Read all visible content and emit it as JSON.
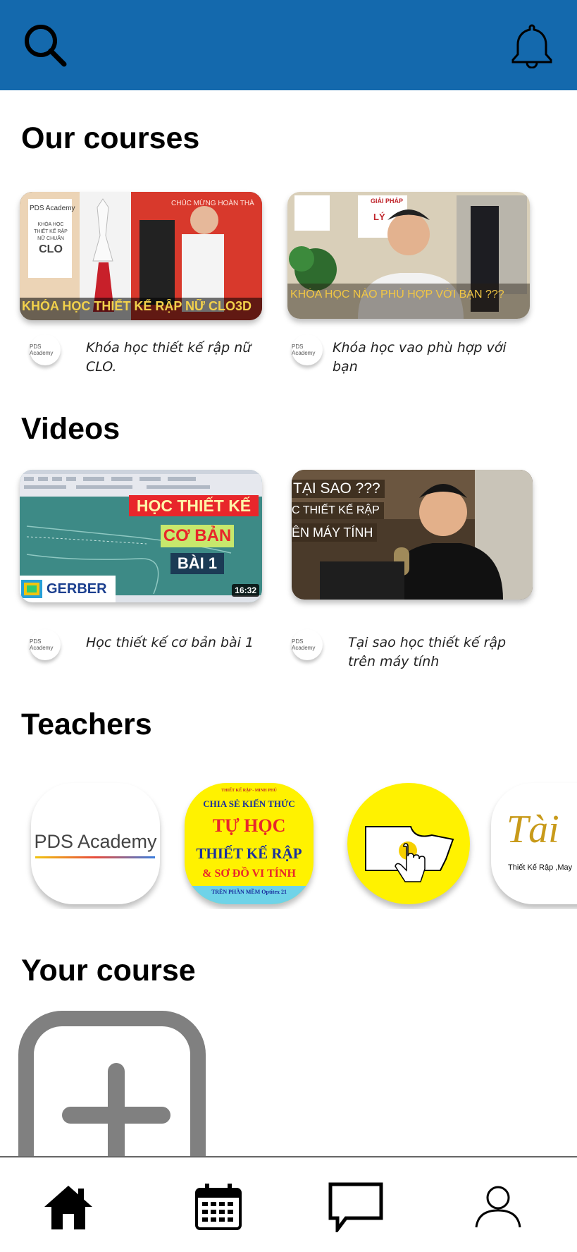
{
  "sections": {
    "courses_title": "Our courses",
    "videos_title": "Videos",
    "teachers_title": "Teachers",
    "your_course_title": "Your course"
  },
  "courses": [
    {
      "banner": "KHÓA HỌC THIẾT KẾ RẬP NỮ CLO3D",
      "logo": "PDS Academy",
      "title": "Khóa học thiết kế rập nữ CLO.",
      "poster_brand": "PDS Academy",
      "poster_lines": [
        "KHÓA HỌC",
        "THIẾT KẾ RẬP",
        "NỮ CHUẨN",
        "CLO"
      ],
      "wall_text": "CHÚC MỪNG HOÀN THÀ"
    },
    {
      "banner": "KHÓA HỌC NÀO PHÙ HỢP VỚI BẠN ???",
      "logo": "PDS Academy",
      "title": "Khóa học vao phù hợp với bạn",
      "wall_text_1": "GIẢI PHÁP",
      "wall_text_2": "LÝ"
    }
  ],
  "videos": [
    {
      "line1": "HỌC THIẾT KẾ",
      "line2": "CƠ BẢN",
      "line3": "BÀI 1",
      "brand": "GERBER",
      "duration": "16:32",
      "logo": "PDS Academy",
      "title": "Học thiết kế cơ bản bài 1"
    },
    {
      "line1": "TẠI SAO ???",
      "line2": "C THIẾT KẾ RẬP",
      "line3": "ÊN MÁY TÍNH",
      "logo": "PDS Academy",
      "title": "Tại sao học thiết kế rập trên máy tính"
    }
  ],
  "teachers": [
    {
      "name": "PDS Academy"
    },
    {
      "line_top": "THIẾT KẾ RẬP - MINH PHÚ",
      "line1": "CHIA SẺ KIẾN THỨC",
      "line2": "TỰ HỌC",
      "line3": "THIẾT KẾ RẬP",
      "line4": "& SƠ ĐỒ VI TÍNH",
      "line5": "TRÊN PHẦN MỀM Optitex 21"
    },
    {
      "icon": "pattern-touch-icon"
    },
    {
      "logo_text": "Tài",
      "caption": "Thiết Kế Rập ,May"
    }
  ],
  "colors": {
    "header": "#1469ad",
    "teacher_yellow": "#fff200",
    "video_bg": "#3d8a86",
    "gerber_blue": "#1b3f8f"
  },
  "nav": [
    {
      "icon": "home-icon",
      "active": true
    },
    {
      "icon": "calendar-icon"
    },
    {
      "icon": "chat-icon"
    },
    {
      "icon": "profile-icon"
    }
  ]
}
